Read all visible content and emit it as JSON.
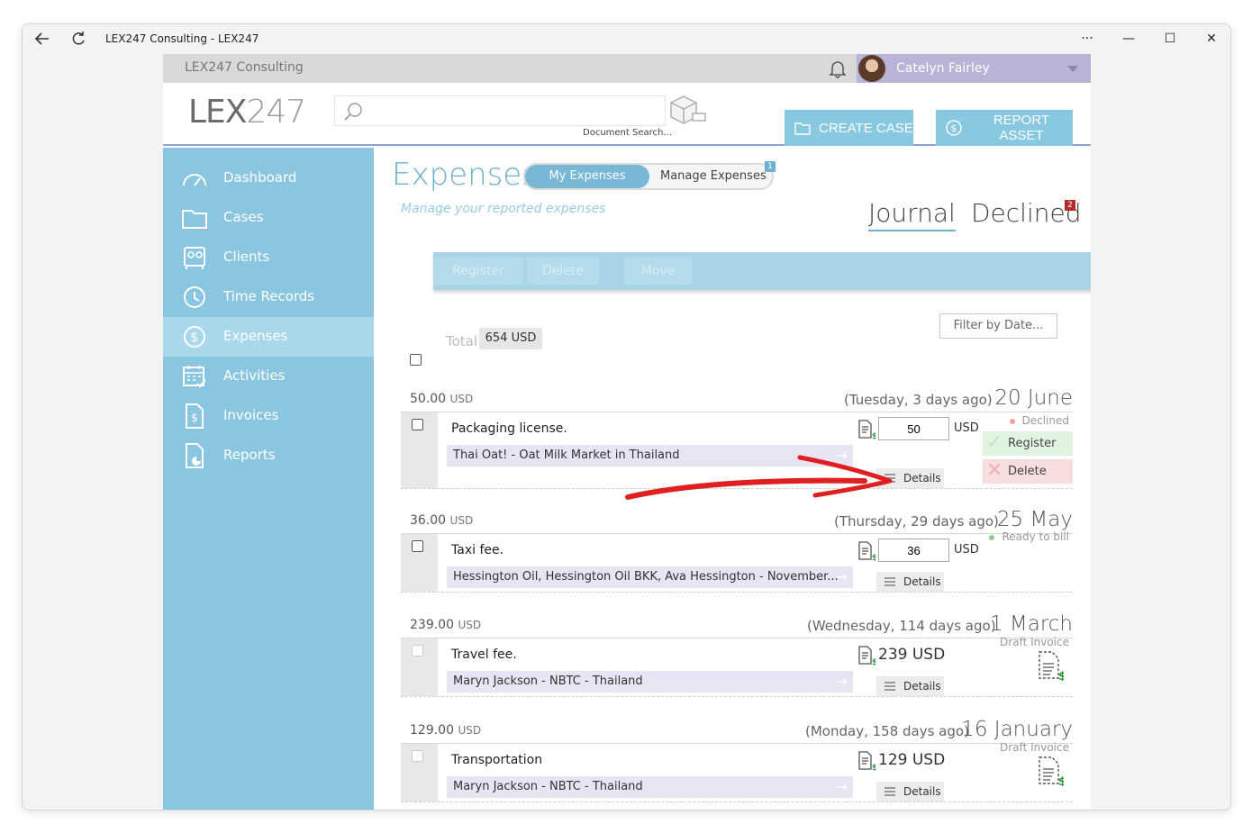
{
  "window": {
    "title": "LEX247 Consulting - LEX247",
    "back_icon": "back-arrow-icon",
    "refresh_icon": "refresh-icon",
    "more_label": "···",
    "minimize_label": "—",
    "maximize_label": "☐",
    "close_label": "✕"
  },
  "topbar": {
    "tenant": "LEX247 Consulting",
    "user_name": "Catelyn Fairley"
  },
  "header": {
    "logo_bold": "LEX",
    "logo_thin": "247",
    "search_placeholder": "",
    "search_label": "Document Search...",
    "create_case": "CREATE CASE",
    "report_asset": "REPORT ASSET"
  },
  "sidebar": {
    "items": [
      {
        "label": "Dashboard",
        "icon": "speedometer-icon"
      },
      {
        "label": "Cases",
        "icon": "folder-icon"
      },
      {
        "label": "Clients",
        "icon": "contacts-icon"
      },
      {
        "label": "Time Records",
        "icon": "clock-icon"
      },
      {
        "label": "Expenses",
        "icon": "dollar-circle-icon",
        "active": true
      },
      {
        "label": "Activities",
        "icon": "calendar-icon"
      },
      {
        "label": "Invoices",
        "icon": "invoice-icon"
      },
      {
        "label": "Reports",
        "icon": "report-icon"
      }
    ]
  },
  "main": {
    "title": "Expenses",
    "seg_my": "My Expenses",
    "seg_manage": "Manage Expenses",
    "seg_badge": "1",
    "subtitle": "Manage your reported expenses",
    "tab_journal": "Journal",
    "tab_declined": "Declined",
    "declined_badge": "2",
    "toolbar": {
      "register": "Register",
      "delete": "Delete",
      "move": "Move"
    },
    "filter": "Filter by Date...",
    "total_label": "Total",
    "total_value": "654 USD"
  },
  "entries": [
    {
      "amount": "50.00",
      "currency": "USD",
      "relative": "(Tuesday, 3 days ago)",
      "date": "20 June",
      "description": "Packaging license.",
      "client": "Thai Oat! - Oat Milk Market in Thailand",
      "input_value": "50",
      "input_currency": "USD",
      "status": "Declined",
      "status_color": "#f08a8a",
      "register": "Register",
      "delete": "Delete",
      "details": "Details"
    },
    {
      "amount": "36.00",
      "currency": "USD",
      "relative": "(Thursday, 29 days ago)",
      "date": "25 May",
      "description": "Taxi fee.",
      "client": "Hessington Oil, Hessington Oil BKK, Ava Hessington - November...",
      "input_value": "36",
      "input_currency": "USD",
      "status": "Ready to bill",
      "status_color": "#7cc87c",
      "details": "Details"
    },
    {
      "amount": "239.00",
      "currency": "USD",
      "relative": "(Wednesday, 114 days ago)",
      "date": "1 March",
      "description": "Travel fee.",
      "client": "Maryn Jackson - NBTC - Thailand",
      "big_amount": "239 USD",
      "status": "Draft Invoice",
      "details": "Details"
    },
    {
      "amount": "129.00",
      "currency": "USD",
      "relative": "(Monday, 158 days ago)",
      "date": "16 January",
      "description": "Transportation",
      "client": "Maryn Jackson - NBTC - Thailand",
      "big_amount": "129 USD",
      "status": "Draft Invoice",
      "details": "Details"
    }
  ],
  "colors": {
    "sidebar": "#8ac6e0",
    "accent": "#6fb0cf",
    "annotation_arrow": "#e02020"
  }
}
